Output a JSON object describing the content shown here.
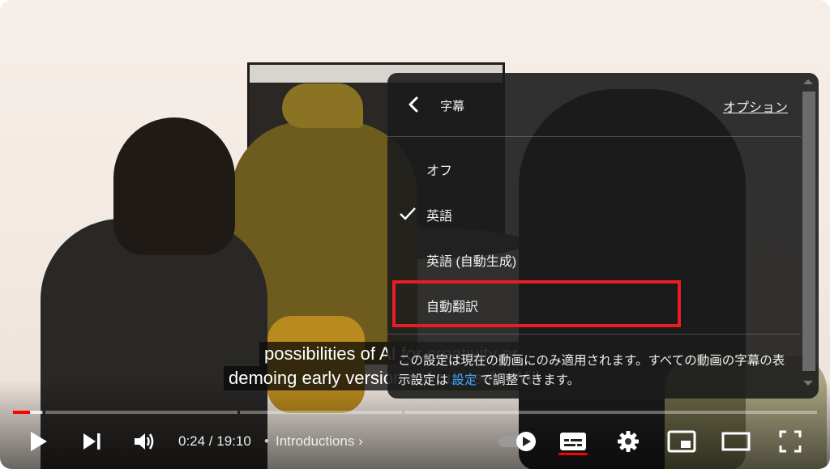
{
  "video": {
    "captions": [
      "possibilities of AI for creativity or",
      "demoing early versions of our tech. Will"
    ],
    "visible_captions": [
      "possibilities o",
      "demoing early ver"
    ]
  },
  "settings_panel": {
    "title": "字幕",
    "options_link": "オプション",
    "items": [
      {
        "label": "オフ",
        "selected": false
      },
      {
        "label": "英語",
        "selected": true
      },
      {
        "label": "英語 (自動生成)",
        "selected": false
      },
      {
        "label": "自動翻訳",
        "selected": false,
        "highlighted": true
      }
    ],
    "note_part1": "この設定は現在の動画にのみ適用されます。すべての動画の字幕の表示設定は",
    "note_link": "設定",
    "note_part2": "で調整できます。",
    "highlight_color": "#ea1c24",
    "link_color": "#3ea6ff"
  },
  "player": {
    "current_time": "0:24",
    "duration": "19:10",
    "time_display": "0:24 / 19:10",
    "chapter": "Introductions",
    "progress_fraction": 0.021,
    "buffered_fraction": 0.036,
    "progress_color": "#ff0000",
    "autoplay": true,
    "subtitles_on": true,
    "icons": [
      "play-icon",
      "next-icon",
      "volume-icon",
      "autoplay-toggle-icon",
      "subtitles-icon",
      "settings-gear-icon",
      "miniplayer-icon",
      "theater-mode-icon",
      "fullscreen-icon"
    ]
  }
}
